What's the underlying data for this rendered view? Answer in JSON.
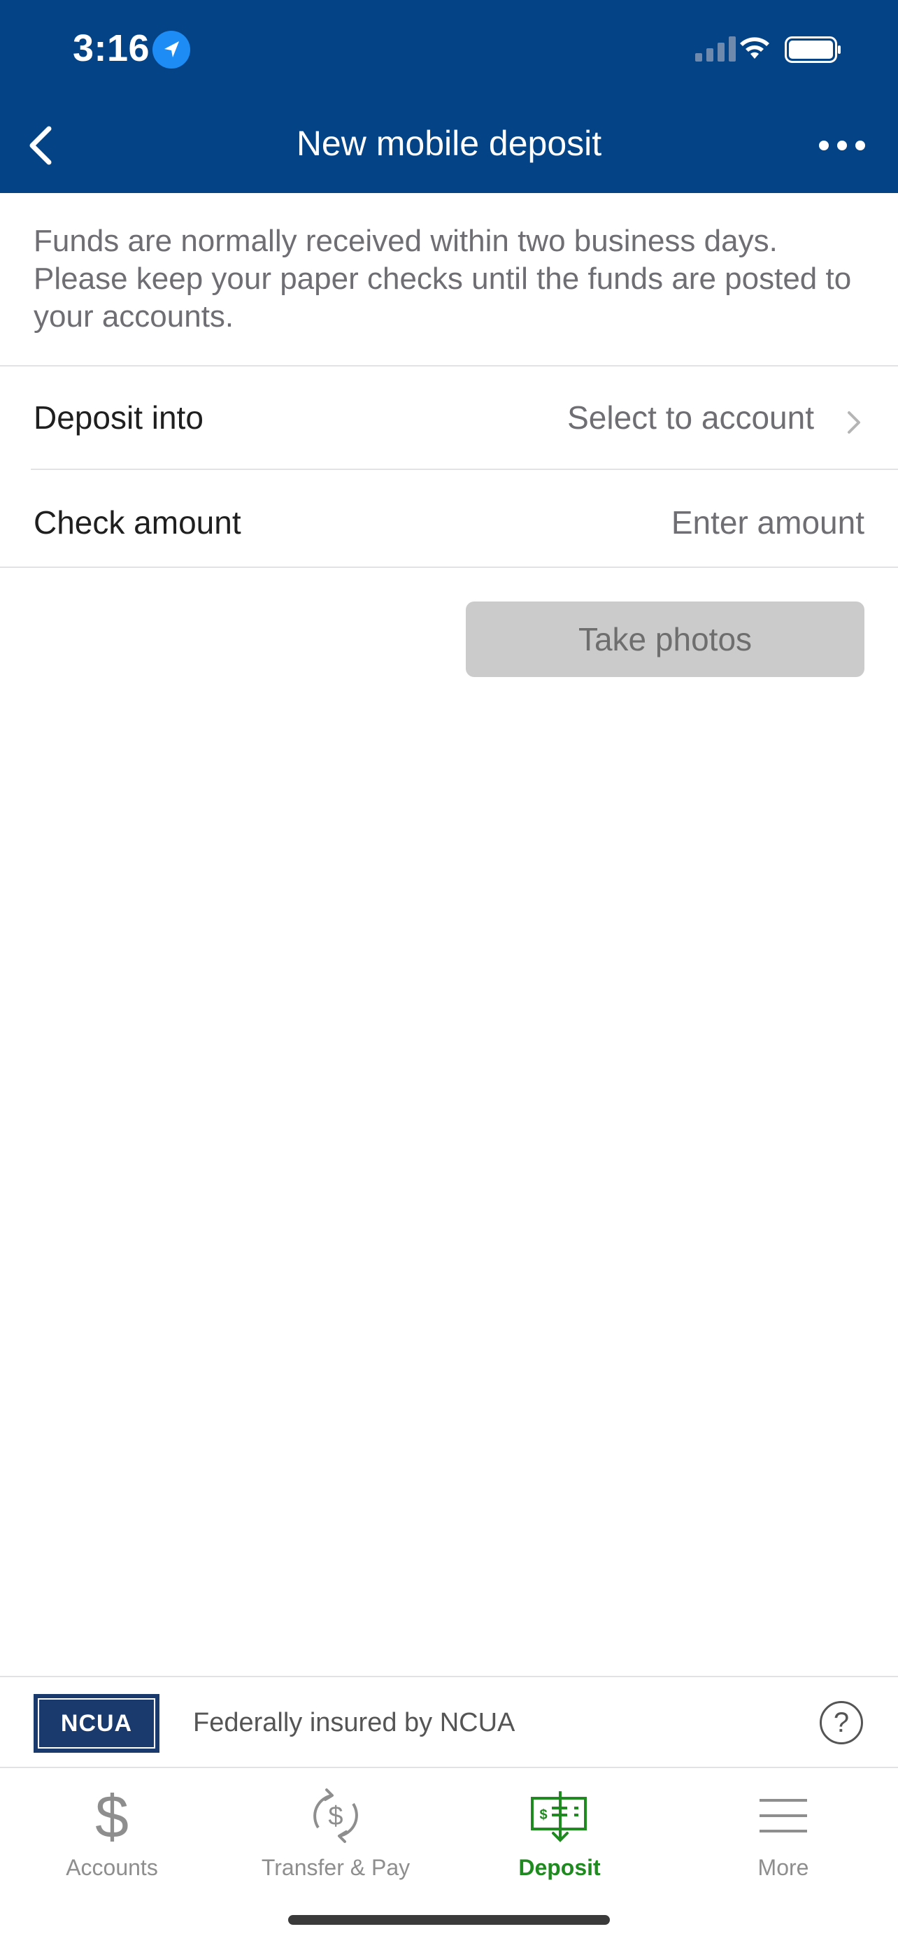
{
  "status_bar": {
    "time": "3:16"
  },
  "header": {
    "title": "New mobile deposit"
  },
  "info_text": "Funds are normally received within two business days. Please keep your paper checks until the funds are posted to your accounts.",
  "deposit_into": {
    "label": "Deposit into",
    "value": "Select to account"
  },
  "check_amount": {
    "label": "Check amount",
    "placeholder": "Enter amount"
  },
  "take_photos_label": "Take photos",
  "footer": {
    "logo_text": "NCUA",
    "insured_text": "Federally insured by NCUA",
    "help_label": "?"
  },
  "tabs": [
    {
      "label": "Accounts",
      "icon": "dollar-icon",
      "active": false
    },
    {
      "label": "Transfer & Pay",
      "icon": "transfer-dollar-icon",
      "active": false
    },
    {
      "label": "Deposit",
      "icon": "check-deposit-icon",
      "active": true
    },
    {
      "label": "More",
      "icon": "menu-icon",
      "active": false
    }
  ],
  "colors": {
    "header_bg": "#044386",
    "active_tab": "#1f8a1f",
    "button_disabled": "#cbcbcb"
  }
}
